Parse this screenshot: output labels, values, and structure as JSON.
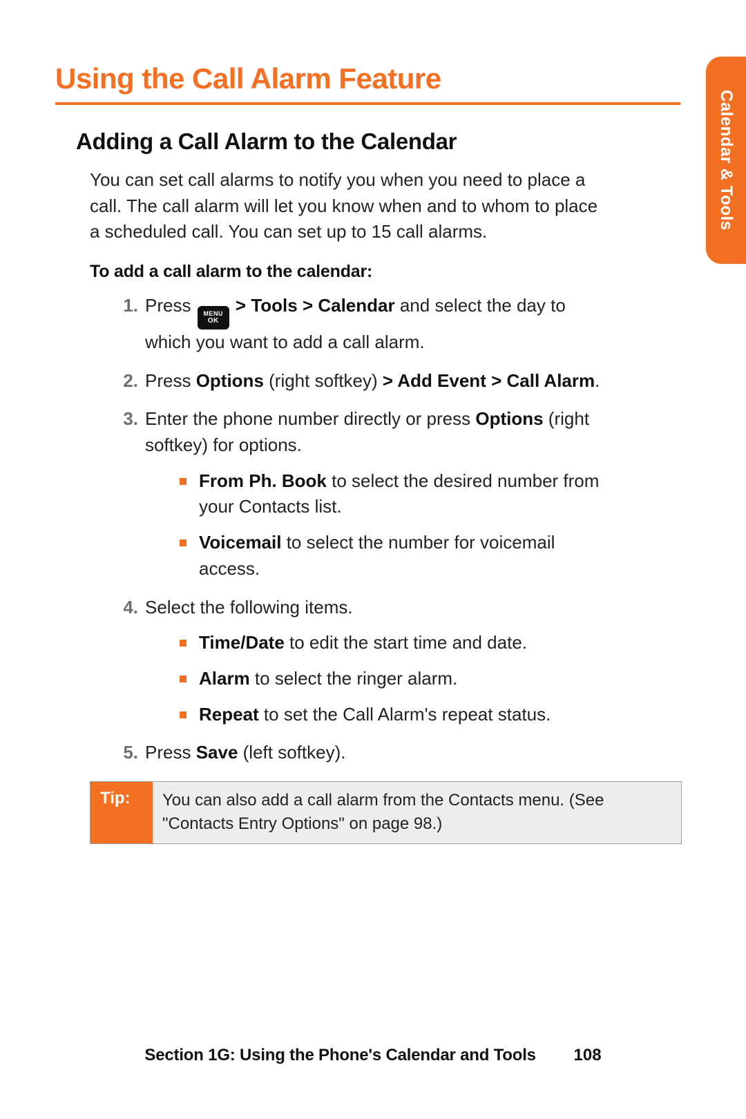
{
  "edge_tab": "Calendar & Tools",
  "page_title": "Using the Call Alarm Feature",
  "section_title": "Adding a Call Alarm to the Calendar",
  "intro": "You can set call alarms to notify you when you need to place a call. The call alarm will let you know when and to whom to place a scheduled call. You can set up to 15 call alarms.",
  "proc_lead": "To add a call alarm to the calendar:",
  "menu_key": {
    "line1": "MENU",
    "line2": "OK"
  },
  "steps": {
    "s1": {
      "num": "1.",
      "t1": "Press ",
      "t2": " > Tools > Calendar",
      "t3": " and select the day to which you want to add a call alarm."
    },
    "s2": {
      "num": "2.",
      "t1": "Press ",
      "b1": "Options",
      "t2": " (right softkey) ",
      "b2": "> Add Event > Call Alarm",
      "t3": "."
    },
    "s3": {
      "num": "3.",
      "t1": "Enter the phone number directly or press ",
      "b1": "Options",
      "t2": " (right softkey) for options.",
      "sub": {
        "a": {
          "b": "From Ph. Book",
          "t": " to select the desired number from your Contacts list."
        },
        "b": {
          "b": "Voicemail",
          "t": " to select the number for voicemail access."
        }
      }
    },
    "s4": {
      "num": "4.",
      "t1": "Select the following items.",
      "sub": {
        "a": {
          "b": "Time/Date",
          "t": " to edit the start time and date."
        },
        "b": {
          "b": "Alarm",
          "t": " to select the ringer alarm."
        },
        "c": {
          "b": "Repeat",
          "t": " to set the Call Alarm's repeat status."
        }
      }
    },
    "s5": {
      "num": "5.",
      "t1": "Press ",
      "b1": "Save",
      "t2": " (left softkey)."
    }
  },
  "tip": {
    "label": "Tip:",
    "text": "You can also add a call alarm from the Contacts menu. (See \"Contacts Entry Options\" on page 98.)"
  },
  "footer": {
    "section": "Section 1G: Using the Phone's Calendar and Tools",
    "page": "108"
  }
}
